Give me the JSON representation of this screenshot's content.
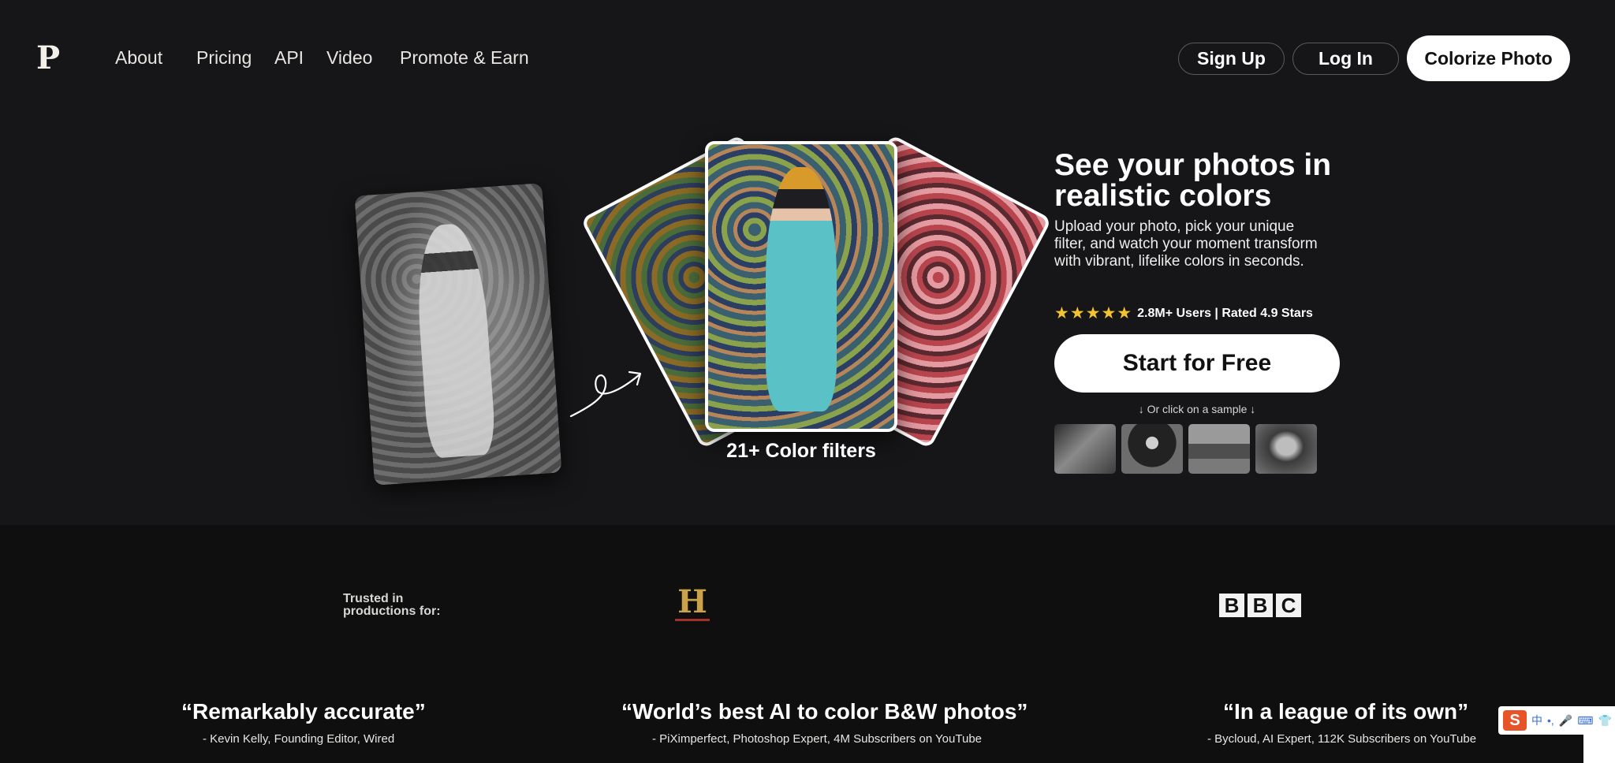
{
  "header": {
    "logo": "P",
    "nav": [
      "About",
      "Pricing",
      "API",
      "Video",
      "Promote & Earn"
    ],
    "sign_up": "Sign Up",
    "log_in": "Log In",
    "colorize": "Colorize Photo"
  },
  "hero": {
    "filters_caption": "21+ Color filters",
    "title": "See your photos in realistic colors",
    "subtitle": "Upload your photo, pick your unique filter, and watch your moment transform with vibrant, lifelike colors in seconds.",
    "stars": "★★★★★",
    "rating": "2.8M+ Users | Rated 4.9 Stars",
    "rating_value": 4.9,
    "cta": "Start for Free",
    "or_sample": "↓ Or click on a sample ↓"
  },
  "trust": {
    "label": "Trusted in productions for:",
    "history_logo": "H",
    "bbc_letters": [
      "B",
      "B",
      "C"
    ]
  },
  "quotes": [
    {
      "text": "“Remarkably accurate”",
      "by": "- Kevin Kelly, Founding Editor, Wired"
    },
    {
      "text": "“World’s best AI to color B&W photos”",
      "by": "- PiXimperfect, Photoshop Expert, 4M Subscribers on YouTube"
    },
    {
      "text": "“In a league of its own”",
      "by": "- Bycloud, AI Expert, 112K Subscribers on YouTube"
    }
  ],
  "ime": {
    "logo": "S",
    "items": [
      "中",
      "•,",
      "🎤",
      "⌨",
      "👕"
    ]
  },
  "colors": {
    "background": "#161517",
    "band": "#0f0f10",
    "star": "#f4c430",
    "button": "#ffffff"
  }
}
